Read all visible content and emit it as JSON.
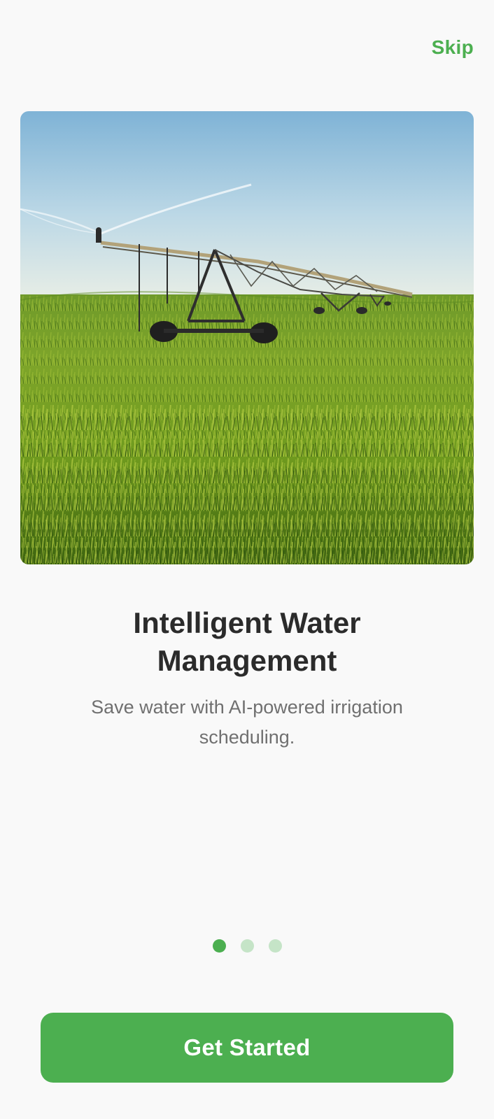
{
  "header": {
    "skip_label": "Skip"
  },
  "hero": {
    "image_icon": "irrigation-field-image"
  },
  "content": {
    "title_line1": "Intelligent Water",
    "title_line2": "Management",
    "subtitle_line1": "Save water with AI-powered irrigation",
    "subtitle_line2": "scheduling."
  },
  "pager": {
    "total": 3,
    "active_index": 0
  },
  "cta": {
    "label": "Get Started"
  },
  "colors": {
    "accent": "#4caf50",
    "dot_inactive": "#c5e4c7",
    "title": "#2b2b2b",
    "subtitle": "#707070",
    "background": "#f9f9f9"
  }
}
